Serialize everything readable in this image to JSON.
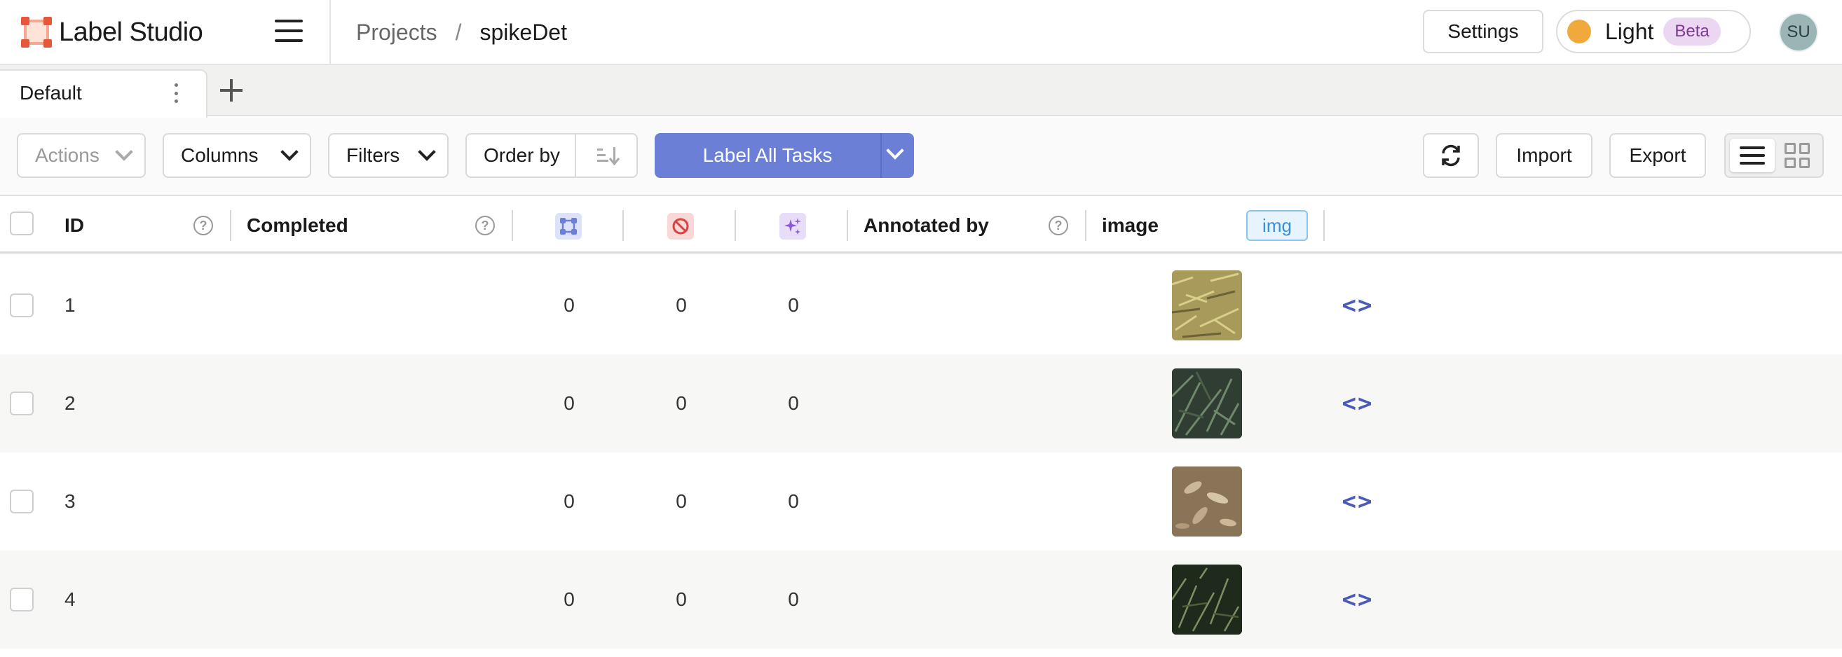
{
  "app": {
    "name": "Label Studio",
    "brand_color": "#e5593a"
  },
  "breadcrumb": {
    "projects": "Projects",
    "separator": "/",
    "current": "spikeDet"
  },
  "header": {
    "settings_label": "Settings",
    "theme_label": "Light",
    "beta_label": "Beta",
    "user_initials": "SU"
  },
  "tabs": [
    {
      "label": "Default",
      "active": true
    }
  ],
  "toolbar": {
    "actions_label": "Actions",
    "columns_label": "Columns",
    "filters_label": "Filters",
    "order_by_label": "Order by",
    "label_all_label": "Label All Tasks",
    "import_label": "Import",
    "export_label": "Export",
    "accent_color": "#6b7fd7"
  },
  "table": {
    "columns": {
      "id": "ID",
      "completed": "Completed",
      "annotations_icon": "annotations-icon",
      "cancelled_icon": "cancelled-icon",
      "predictions_icon": "predictions-icon",
      "annotated_by": "Annotated by",
      "image": "image",
      "image_tag": "img"
    },
    "rows": [
      {
        "id": "1",
        "annotations": "0",
        "cancelled": "0",
        "predictions": "0",
        "thumb_color": "#a89a5a"
      },
      {
        "id": "2",
        "annotations": "0",
        "cancelled": "0",
        "predictions": "0",
        "thumb_color": "#2f3d32"
      },
      {
        "id": "3",
        "annotations": "0",
        "cancelled": "0",
        "predictions": "0",
        "thumb_color": "#8a7458"
      },
      {
        "id": "4",
        "annotations": "0",
        "cancelled": "0",
        "predictions": "0",
        "thumb_color": "#1f2a1c"
      }
    ]
  }
}
